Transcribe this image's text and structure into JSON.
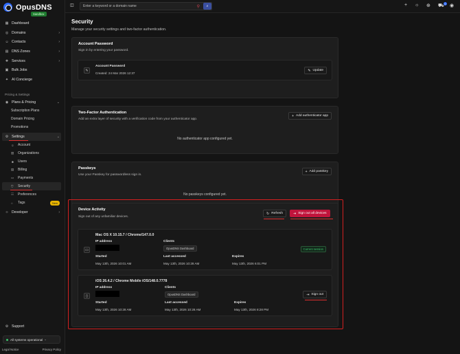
{
  "brand": {
    "name": "OpusDNS",
    "env_badge": "Sandbox"
  },
  "sidebar": {
    "primary": [
      {
        "label": "Dashboard",
        "icon": "dashboard-icon",
        "has_chevron": false
      },
      {
        "label": "Domains",
        "icon": "globe-icon",
        "has_chevron": true
      },
      {
        "label": "Contacts",
        "icon": "contacts-icon",
        "has_chevron": true
      },
      {
        "label": "DNS Zones",
        "icon": "dns-icon",
        "has_chevron": true
      },
      {
        "label": "Services",
        "icon": "services-icon",
        "has_chevron": true
      },
      {
        "label": "Bulk Jobs",
        "icon": "bulk-jobs-icon",
        "has_chevron": false
      },
      {
        "label": "AI Concierge",
        "icon": "ai-icon",
        "has_chevron": false
      }
    ],
    "section_label": "Pricing & Settings",
    "plans": {
      "label": "Plans & Pricing",
      "children": [
        "Subscription Plans",
        "Domain Pricing",
        "Promotions"
      ]
    },
    "settings": {
      "label": "Settings",
      "children": [
        {
          "label": "Account",
          "icon": "user-icon"
        },
        {
          "label": "Organizations",
          "icon": "organization-icon"
        },
        {
          "label": "Users",
          "icon": "users-icon"
        },
        {
          "label": "Billing",
          "icon": "billing-icon"
        },
        {
          "label": "Payments",
          "icon": "payments-icon"
        },
        {
          "label": "Security",
          "icon": "shield-icon"
        },
        {
          "label": "Preferences",
          "icon": "preferences-icon"
        },
        {
          "label": "Tags",
          "icon": "tag-icon",
          "badge": "New"
        }
      ]
    },
    "developer": "Developer",
    "support": "Support",
    "status": "All systems operational",
    "footer": {
      "legal": "Legal Notice",
      "privacy": "Privacy Policy"
    }
  },
  "topbar": {
    "search_placeholder": "Enter a keyword or a domain name",
    "cart_count": "0"
  },
  "page": {
    "title": "Security",
    "subtitle": "Manage your security settings and two-factor authentication."
  },
  "account_password": {
    "title": "Account Password",
    "desc": "Sign in by entering your password.",
    "item_title": "Account Password",
    "item_created": "Created: 24 Mar 2026 12:37",
    "button": "Update"
  },
  "two_factor": {
    "title": "Two-Factor Authentication",
    "desc": "Add an extra layer of security with a verification code from your authenticator app.",
    "button": "Add authenticator app",
    "empty": "No authenticator app configured yet."
  },
  "passkeys": {
    "title": "Passkeys",
    "desc": "Use your Passkey for passwordless sign in.",
    "button": "Add passkey",
    "empty": "No passkeys configured yet."
  },
  "device_activity": {
    "title": "Device Activity",
    "desc": "Sign out of any unfamiliar devices.",
    "refresh": "Refresh",
    "sign_out_all": "Sign out all devices",
    "labels": {
      "ip": "IP address",
      "clients": "Clients",
      "started": "Started",
      "last": "Last accessed",
      "expires": "Expires"
    },
    "devices": [
      {
        "name": "Mac OS X 10.15.7 / Chrome/147.0.0",
        "client": "OpusDNS Dashboard",
        "started": "May 13th, 2026 10:01 AM",
        "last": "May 13th, 2026 10:28 AM",
        "expires": "May 13th, 2026 6:01 PM",
        "session": "Current session"
      },
      {
        "name": "iOS 26.4.2 / Chrome Mobile iOS/148.0.7778",
        "client": "OpusDNS Dashboard",
        "started": "May 13th, 2026 10:28 AM",
        "last": "May 13th, 2026 10:28 AM",
        "expires": "May 13th, 2026 8:28 PM",
        "action": "Sign out"
      }
    ]
  },
  "colors": {
    "accent": "#2f6bff",
    "danger": "#c0143c",
    "success": "#3cbf6a",
    "annotation": "#d42020"
  }
}
